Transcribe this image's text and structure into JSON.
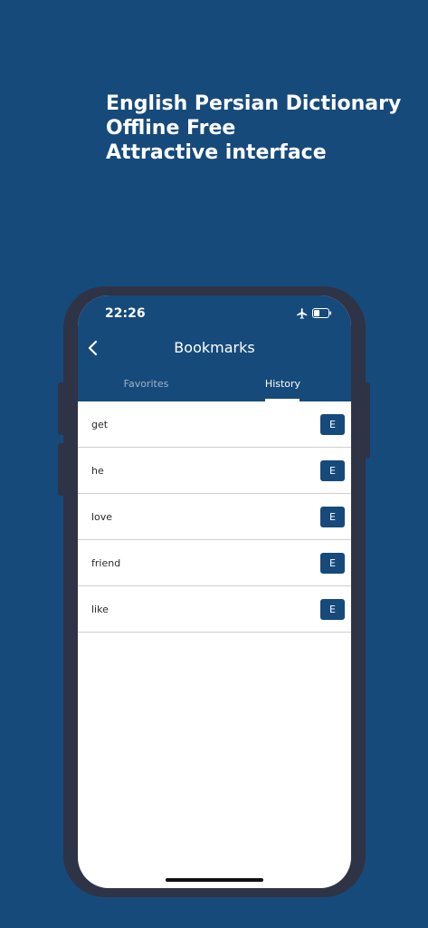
{
  "promo": {
    "line1": "English Persian Dictionary",
    "line2": "Offline Free",
    "line3": "Attractive interface"
  },
  "status_bar": {
    "time": "22:26",
    "icons": [
      "airplane-icon",
      "battery-icon"
    ],
    "battery_level": 0.4
  },
  "header": {
    "title": "Bookmarks",
    "back_icon": "chevron-left-icon"
  },
  "tabs": [
    {
      "label": "Favorites",
      "active": false
    },
    {
      "label": "History",
      "active": true
    }
  ],
  "history": [
    {
      "word": "get",
      "badge": "E"
    },
    {
      "word": "he",
      "badge": "E"
    },
    {
      "word": "love",
      "badge": "E"
    },
    {
      "word": "friend",
      "badge": "E"
    },
    {
      "word": "like",
      "badge": "E"
    }
  ],
  "colors": {
    "brand": "#164a7b",
    "phone_frame": "#2f3346",
    "inactive_tab": "#9fb3c8"
  }
}
